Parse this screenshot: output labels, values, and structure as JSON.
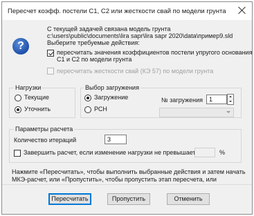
{
  "window": {
    "title": "Пересчет коэфф. постели С1, С2 или жесткости свай по модели грунта"
  },
  "intro": {
    "line1": "С текущей задачей связана модель грунта",
    "line2": "c:\\users\\public\\documents\\lira sapr\\lira sapr 2020\\data\\пример9.sld",
    "line3": "Выберите требуемые действия:"
  },
  "options": {
    "recalc_c1c2_line1": "пересчитать значения коэффициентов постели упругого основания",
    "recalc_c1c2_line2": "С1 и С2 по модели грунта",
    "recalc_c1c2_checked": true,
    "recalc_piles": "пересчитать жесткости свай (КЭ 57) по модели грунта",
    "recalc_piles_checked": false
  },
  "loads": {
    "label": "Нагрузки",
    "current": "Текущие",
    "refine": "Уточнить",
    "selected": "refine"
  },
  "loading_choice": {
    "label": "Выбор загружения",
    "loading": "Загружение",
    "rsn": "РСН",
    "selected": "loading",
    "number_label": "№ загружения",
    "number_value": "1"
  },
  "calc_params": {
    "label": "Параметры расчета",
    "iterations_label": "Количество итераций",
    "iterations_value": "3",
    "finish_label": "Завершить расчет, если изменение нагрузки не превышает",
    "finish_checked": false,
    "finish_value": "",
    "percent": "%"
  },
  "info_text": "Нажмите «Пересчитать», чтобы выполнить выбранные действия и затем начать МКЭ-расчет, или «Пропустить», чтобы пропустить этап пересчета, или «Отменить» для отмены всех расчетов",
  "buttons": {
    "recalculate": "Пересчитать",
    "skip": "Пропустить",
    "cancel": "Отменить"
  },
  "icons": {
    "dialog_icon": "question-icon",
    "close": "close-icon"
  },
  "colors": {
    "accent": "#0078d7",
    "icon_blue": "#1f4fa8"
  }
}
